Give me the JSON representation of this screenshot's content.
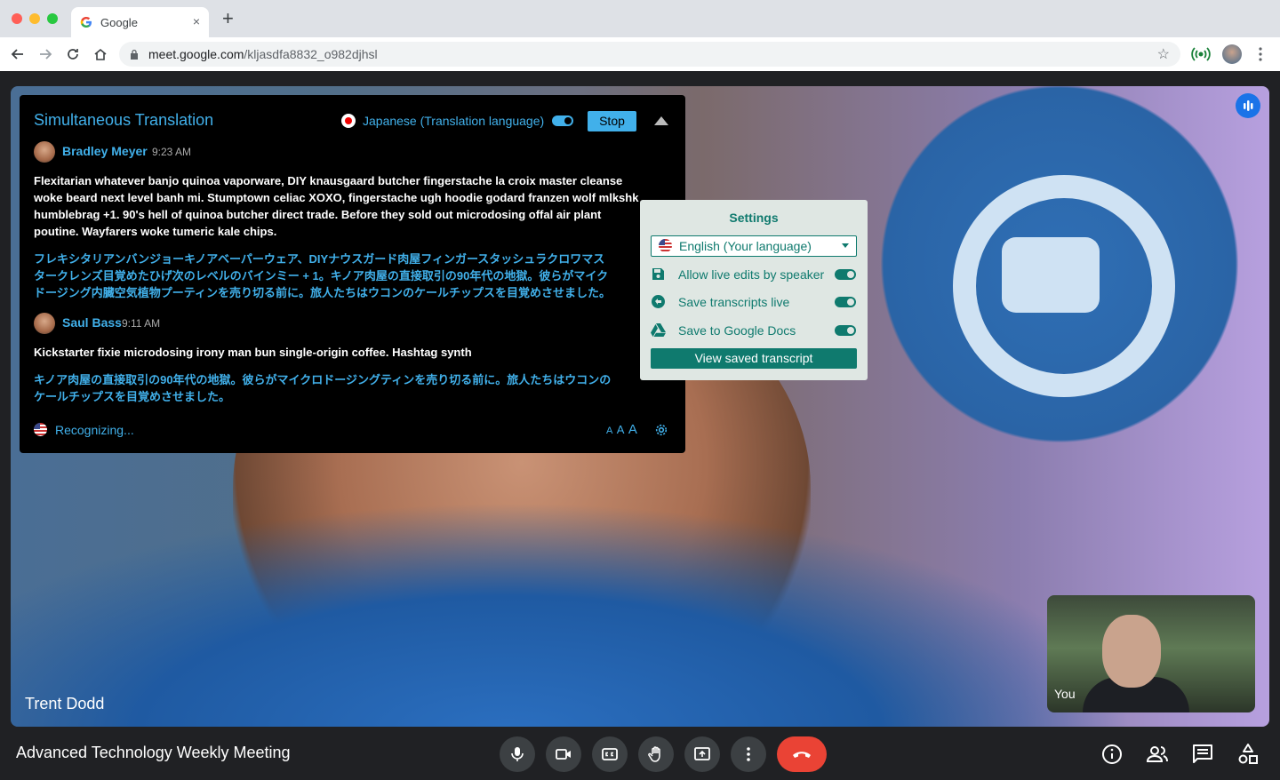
{
  "browser": {
    "tab_title": "Google",
    "tab_close": "×",
    "new_tab": "+",
    "url_domain": "meet.google.com",
    "url_path": "/kljasdfa8832_o982djhsl",
    "bookmark_star": "☆"
  },
  "translation_panel": {
    "title": "Simultaneous Translation",
    "language_label": "Japanese (Translation language)",
    "stop_label": "Stop",
    "entries": [
      {
        "speaker": "Bradley Meyer",
        "time": "9:23 AM",
        "text": "Flexitarian whatever banjo quinoa vaporware, DIY knausgaard butcher fingerstache la croix master cleanse\nwoke beard next level banh mi. Stumptown celiac XOXO, fingerstache ugh hoodie godard franzen wolf mlkshk\nhumblebrag +1. 90's hell of quinoa butcher direct trade. Before they sold out microdosing offal air plant\npoutine. Wayfarers woke tumeric kale chips.",
        "translation": "フレキシタリアンバンジョーキノアベーパーウェア、DIYナウスガード肉屋フィンガースタッシュラクロワマス\nタークレンズ目覚めたひげ次のレベルのバインミー + 1。キノア肉屋の直接取引の90年代の地獄。彼らがマイク\nドージング内臓空気植物プーティンを売り切る前に。旅人たちはウコンのケールチップスを目覚めさせました。"
      },
      {
        "speaker": "Saul Bass",
        "time": "9:11 AM",
        "text": "Kickstarter fixie microdosing irony man bun single-origin coffee. Hashtag synth",
        "translation": "キノア肉屋の直接取引の90年代の地獄。彼らがマイクロドージングティンを売り切る前に。旅人たちはウコンの\nケールチップスを目覚めさせました。"
      }
    ],
    "status": "Recognizing...",
    "font_sizes": [
      "A",
      "A",
      "A"
    ]
  },
  "settings": {
    "title": "Settings",
    "language": "English (Your language)",
    "options": [
      {
        "label": "Allow live edits by speaker",
        "icon": "save-icon",
        "on": true
      },
      {
        "label": "Save transcripts live",
        "icon": "transcript-icon",
        "on": true
      },
      {
        "label": "Save to Google Docs",
        "icon": "google-drive-icon",
        "on": true
      }
    ],
    "view_button": "View saved transcript"
  },
  "video": {
    "participant": "Trent Dodd",
    "self_label": "You"
  },
  "bottom_bar": {
    "meeting_title": "Advanced Technology Weekly Meeting"
  },
  "colors": {
    "accent_blue": "#41b0ea",
    "settings_green": "#0f7a6e",
    "hangup_red": "#ea4335"
  }
}
